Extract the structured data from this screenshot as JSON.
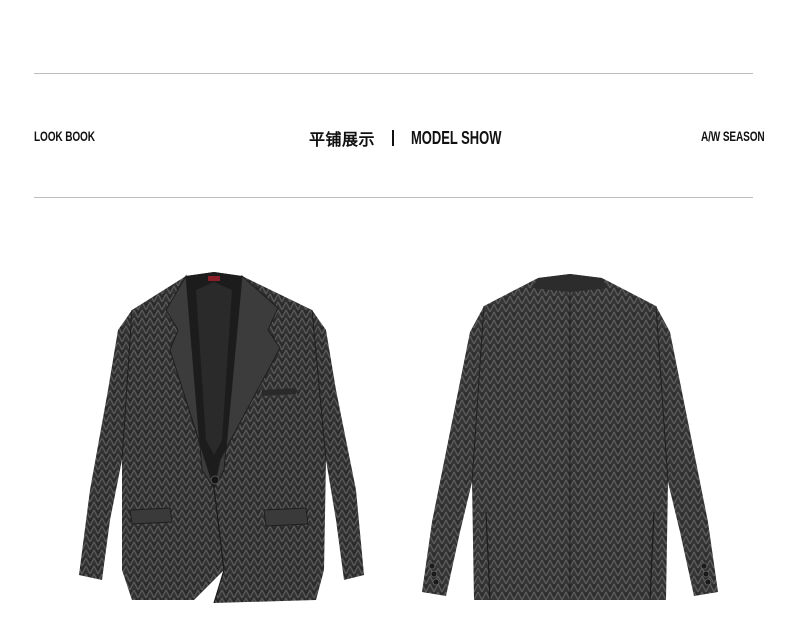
{
  "header": {
    "left_label": "LOOK BOOK",
    "title_cn": "平铺展示",
    "title_en": "MODEL SHOW",
    "right_label": "A/W SEASON"
  },
  "colors": {
    "fabric_dark": "#2b2b2b",
    "fabric_mid": "#4a4a4a",
    "lining": "#1a1a1a",
    "rule": "#bdbdbd"
  },
  "images": {
    "front": "blazer-front-photo",
    "back": "blazer-back-photo"
  }
}
